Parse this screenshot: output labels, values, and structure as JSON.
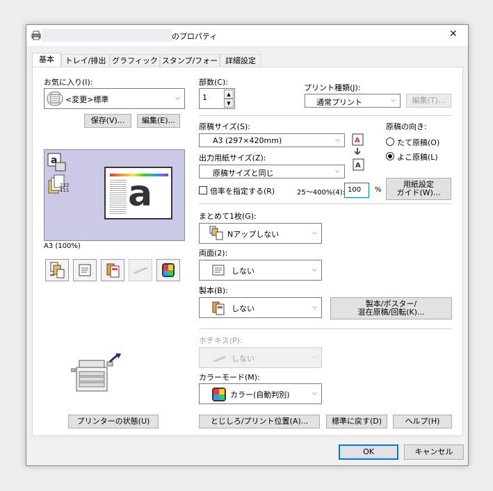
{
  "window": {
    "title_suffix": "のプロパティ",
    "close_glyph": "✕"
  },
  "tabs": [
    {
      "label": "基本"
    },
    {
      "label": "トレイ/排出"
    },
    {
      "label": "グラフィックス"
    },
    {
      "label": "スタンプ/フォーム"
    },
    {
      "label": "詳細設定"
    }
  ],
  "favorites": {
    "label": "お気に入り(I):",
    "value": "<変更>標準",
    "save": "保存(V)...",
    "edit": "編集(E)..."
  },
  "preview": {
    "caption": "A3 (100%)",
    "glyph_a": "a",
    "tray_text": "222\n111"
  },
  "copies": {
    "label": "部数(C):",
    "value": "1"
  },
  "print_type": {
    "label": "プリント種類(J):",
    "value": "通常プリント",
    "edit": "編集(T)..."
  },
  "original_size": {
    "label": "原稿サイズ(S):",
    "value": "A3 (297×420mm)"
  },
  "output_size": {
    "label": "出力用紙サイズ(Z):",
    "value": "原稿サイズと同じ"
  },
  "orientation": {
    "label": "原稿の向き:",
    "portrait": "たて原稿(O)",
    "landscape": "よこ原稿(L)",
    "selected": "landscape"
  },
  "zoom": {
    "label": "倍率を指定する(R)",
    "range": "25〜400%(4):",
    "value": "100",
    "unit": "%"
  },
  "paper_guide": {
    "line1": "用紙設定",
    "line2": "ガイド(W)..."
  },
  "nup": {
    "label": "まとめて1枚(G):",
    "value": "Nアップしない"
  },
  "duplex": {
    "label": "両面(2):",
    "value": "しない"
  },
  "booklet": {
    "label": "製本(B):",
    "value": "しない",
    "button_line1": "製本/ポスター/",
    "button_line2": "混在原稿/回転(K)..."
  },
  "staple": {
    "label": "ホチキス(P):",
    "value": "しない"
  },
  "color_mode": {
    "label": "カラーモード(M):",
    "value": "カラー(自動判別)"
  },
  "bottom": {
    "printer_status": "プリンターの状態(U)",
    "binding": "とじしろ/プリント位置(A)...",
    "defaults": "標準に戻す(D)",
    "help": "ヘルプ(H)"
  },
  "footer": {
    "ok": "OK",
    "cancel": "キャンセル"
  },
  "colors": {
    "preview_bg": "#c9c9e6",
    "accent": "#0078d7"
  }
}
